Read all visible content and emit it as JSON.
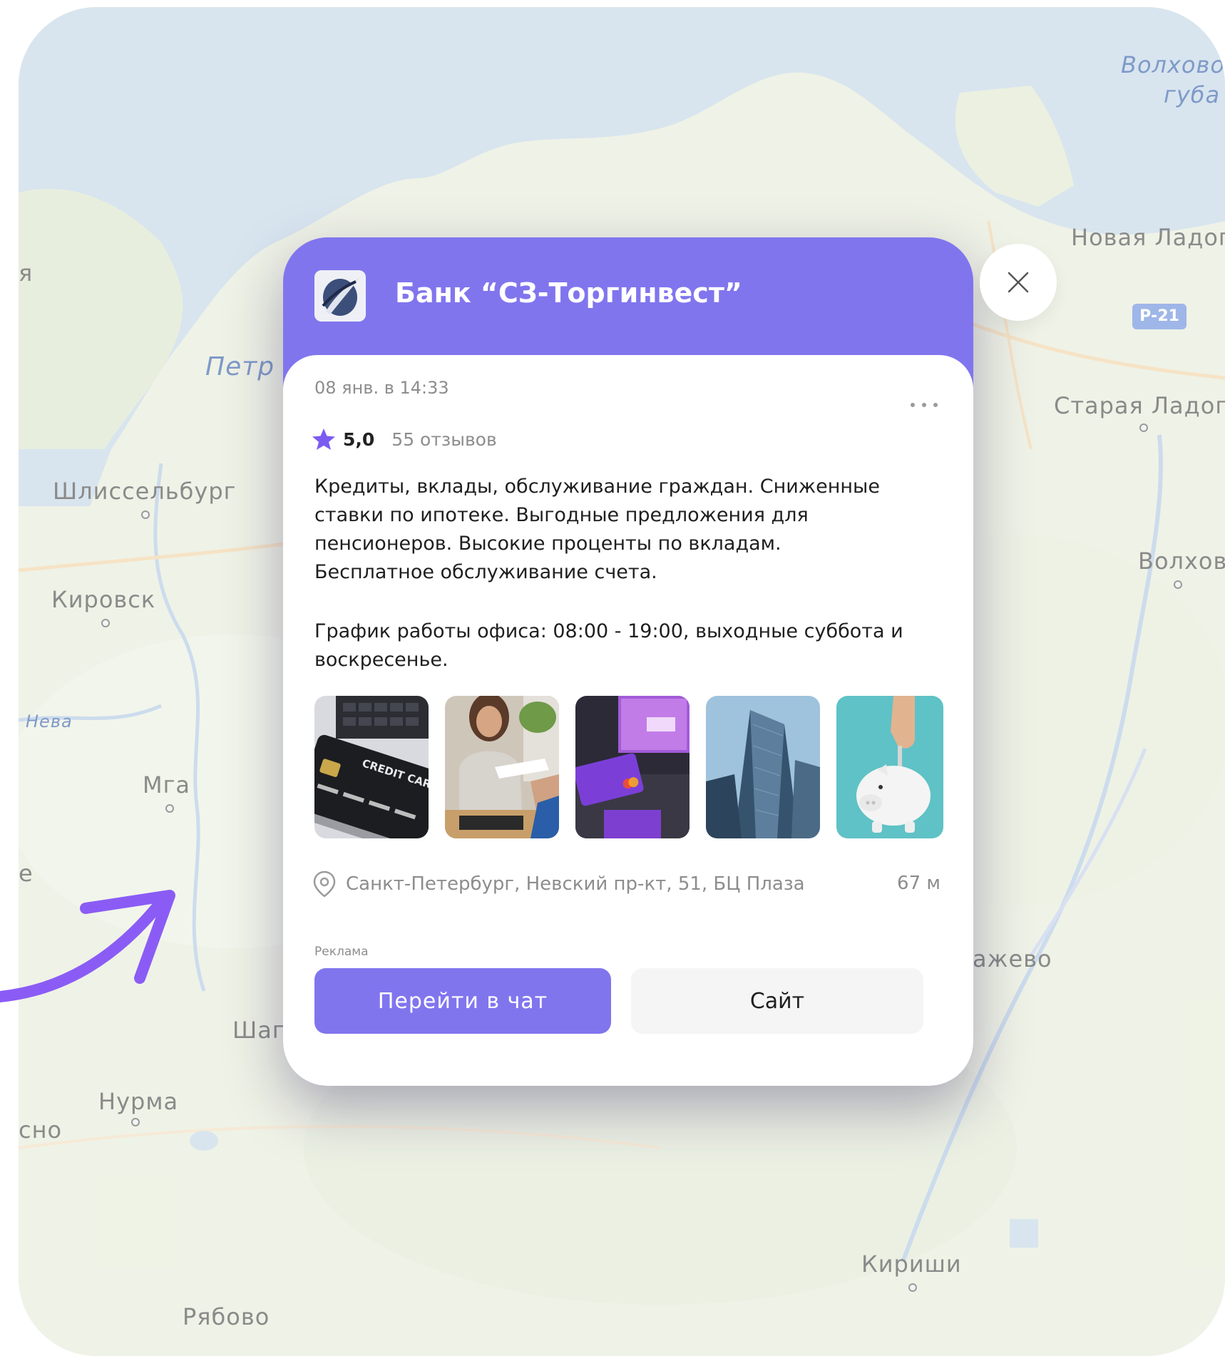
{
  "map": {
    "labels": {
      "shlisselburg": "Шлиссельбург",
      "kirovsk": "Кировск",
      "mga": "Мга",
      "nurma": "Нурма",
      "kirishi": "Кириши",
      "ryabovo": "Рябово",
      "novaya_ladoga": "Новая Ладог",
      "staraya_ladoga": "Старая Ладога",
      "volkhov": "Волхов",
      "volkhov_bay_1": "Волхово",
      "volkhov_bay_2": "губа",
      "petro": "Петр",
      "neva": "Нева",
      "shap": "Шап",
      "razhevo": "ажево",
      "edge_sno": "сно",
      "edge_a": "я",
      "edge_e": "е",
      "road_label": "Р-21"
    }
  },
  "card": {
    "bank_name": "Банк “СЗ-Торгинвест”",
    "timestamp": "08 янв. в 14:33",
    "rating": "5,0",
    "reviews": "55 отзывов",
    "description": "Кредиты, вклады, обслуживание граждан. Сниженные\nставки по ипотеке. Выгодные предложения для\nпенсионеров. Высокие проценты по вкладам.\nБесплатное обслуживание счета.",
    "schedule": "График работы офиса: 08:00 - 19:00, выходные суббота и\nвоскресенье.",
    "photo_card_text": "CREDIT CARD",
    "address": "Санкт-Петербург, Невский пр-кт, 51, БЦ Плаза",
    "distance": "67 м",
    "ad_label": "Реклама",
    "chat_button": "Перейти в чат",
    "site_button": "Сайт"
  },
  "colors": {
    "accent": "#8175ee",
    "star": "#7b5cf0",
    "arrow": "#8a5cf5"
  },
  "icons": [
    "star-icon",
    "location-pin-icon",
    "close-icon",
    "more-dots-icon",
    "bank-logo-icon"
  ]
}
